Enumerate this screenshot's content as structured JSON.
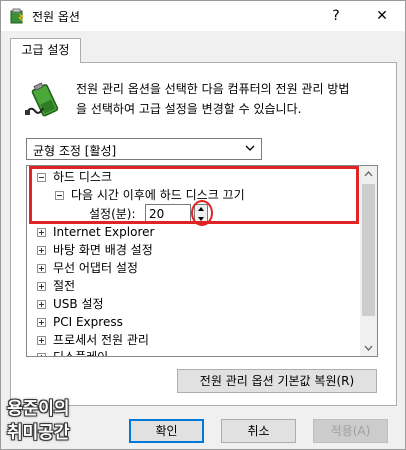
{
  "window": {
    "title": "전원 옵션",
    "help_label": "?",
    "close_label": "✕"
  },
  "tab": {
    "label": "고급 설정"
  },
  "description": {
    "line1": "전원 관리 옵션을 선택한 다음 컴퓨터의 전원 관리 방법",
    "line2": "을 선택하여 고급 설정을 변경할 수 있습니다."
  },
  "plan_select": {
    "value": "균형 조정 [활성]"
  },
  "tree": {
    "hard_disk": {
      "label": "하드 디스크",
      "expanded": true
    },
    "turn_off_after": {
      "label": "다음 시간 이후에 하드 디스크 끄기",
      "expanded": true
    },
    "setting": {
      "label": "설정(분):",
      "value": "20"
    },
    "items": [
      {
        "label": "Internet Explorer"
      },
      {
        "label": "바탕 화면 배경 설정"
      },
      {
        "label": "무선 어댑터 설정"
      },
      {
        "label": "절전"
      },
      {
        "label": "USB 설정"
      },
      {
        "label": "PCI Express"
      },
      {
        "label": "프로세서 전원 관리"
      },
      {
        "label": "디스플레이"
      }
    ]
  },
  "buttons": {
    "restore": "전원 관리 옵션 기본값 복원(R)",
    "ok": "확인",
    "cancel": "취소",
    "apply": "적용(A)"
  },
  "watermark": {
    "line1": "용준이의",
    "line2": "취미공간"
  },
  "colors": {
    "highlight": "#e02424",
    "focus": "#0078d7"
  }
}
